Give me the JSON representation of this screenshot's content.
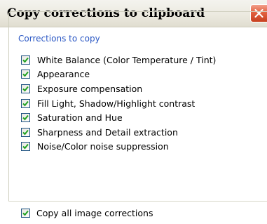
{
  "window": {
    "title": "Copy corrections to clipboard"
  },
  "group": {
    "legend": "Corrections to copy",
    "items": [
      {
        "label": "White Balance (Color Temperature / Tint)",
        "checked": true
      },
      {
        "label": "Appearance",
        "checked": true
      },
      {
        "label": "Exposure compensation",
        "checked": true
      },
      {
        "label": "Fill Light, Shadow/Highlight contrast",
        "checked": true
      },
      {
        "label": "Saturation and Hue",
        "checked": true
      },
      {
        "label": "Sharpness and Detail extraction",
        "checked": true
      },
      {
        "label": "Noise/Color noise suppression",
        "checked": true
      }
    ]
  },
  "copy_all": {
    "label": "Copy all image corrections",
    "checked": true
  },
  "colors": {
    "legend": "#2a57c4",
    "checkmark": "#21a121",
    "close_button": "#e2603f"
  },
  "icons": {
    "close": "close-x-icon",
    "check": "checkmark-icon"
  }
}
